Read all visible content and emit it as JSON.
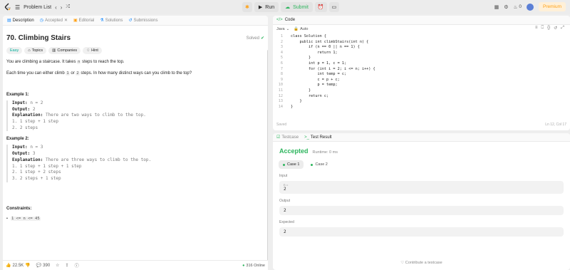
{
  "topbar": {
    "problem_list": "Problem List",
    "run": "Run",
    "submit": "Submit",
    "notif_count": "0",
    "premium": "Premium"
  },
  "left_tabs": {
    "description": "Description",
    "accepted": "Accepted",
    "editorial": "Editorial",
    "solutions": "Solutions",
    "submissions": "Submissions"
  },
  "problem": {
    "title": "70. Climbing Stairs",
    "solved": "Solved",
    "difficulty": "Easy",
    "topics": "Topics",
    "companies": "Companies",
    "hint": "Hint",
    "p1a": "You are climbing a staircase. It takes",
    "p1code": "n",
    "p1b": "steps to reach the top.",
    "p2a": "Each time you can either climb",
    "p2code1": "1",
    "p2mid": "or",
    "p2code2": "2",
    "p2b": "steps. In how many distinct ways can you climb to the top?",
    "example1_title": "Example 1:",
    "ex1_input_label": "Input:",
    "ex1_input": "n = 2",
    "ex1_output_label": "Output:",
    "ex1_output": "2",
    "ex1_expl_label": "Explanation:",
    "ex1_expl": "There are two ways to climb to the top.",
    "ex1_lines": [
      "1. 1 step + 1 step",
      "2. 2 steps"
    ],
    "example2_title": "Example 2:",
    "ex2_input_label": "Input:",
    "ex2_input": "n = 3",
    "ex2_output_label": "Output:",
    "ex2_output": "3",
    "ex2_expl_label": "Explanation:",
    "ex2_expl": "There are three ways to climb to the top.",
    "ex2_lines": [
      "1. 1 step + 1 step + 1 step",
      "2. 1 step + 2 steps",
      "3. 2 steps + 1 step"
    ],
    "constraints_title": "Constraints:",
    "constraint": "1 <= n <= 45"
  },
  "left_bottom": {
    "likes": "22.5K",
    "comments": "390",
    "online": "316 Online"
  },
  "code": {
    "header": "Code",
    "language": "Java",
    "auto": "Auto",
    "saved": "Saved",
    "position": "Ln 12, Col 17",
    "lines": [
      "class Solution {",
      "    public int climbStairs(int n) {",
      "        if (n == 0 || n == 1) {",
      "            return 1;",
      "        }",
      "        int p = 1, c = 1;",
      "        for (int i = 2; i <= n; i++) {",
      "            int temp = c;",
      "            c = p + c;",
      "            p = temp;",
      "        }",
      "        return c;",
      "    }",
      "}"
    ]
  },
  "result": {
    "testcase_tab": "Testcase",
    "result_tab": "Test Result",
    "status": "Accepted",
    "runtime": "Runtime: 0 ms",
    "case1": "Case 1",
    "case2": "Case 2",
    "input_label": "Input",
    "input_var": "n =",
    "input_val": "2",
    "output_label": "Output",
    "output_val": "2",
    "expected_label": "Expected",
    "expected_val": "2",
    "contribute": "Contribute a testcase"
  },
  "colors": {
    "accent_orange": "#ffa116",
    "accept_green": "#2db55d",
    "easy_teal": "#00af9b"
  }
}
